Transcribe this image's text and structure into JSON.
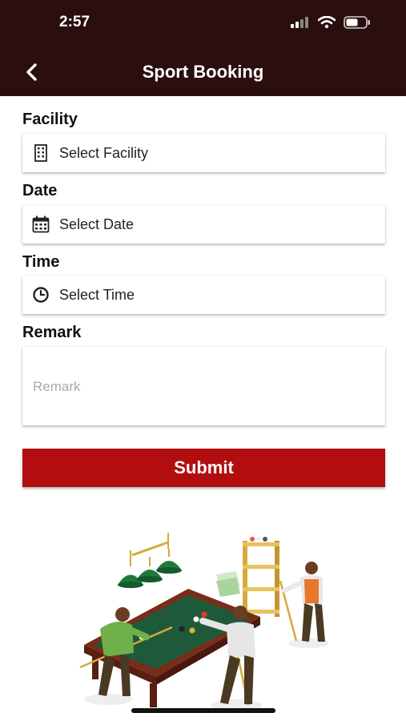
{
  "status_bar": {
    "time": "2:57"
  },
  "header": {
    "title": "Sport Booking"
  },
  "form": {
    "facility": {
      "label": "Facility",
      "value": "Select Facility",
      "icon": "building-icon"
    },
    "date": {
      "label": "Date",
      "value": "Select Date",
      "icon": "calendar-icon"
    },
    "time": {
      "label": "Time",
      "value": "Select Time",
      "icon": "clock-icon"
    },
    "remark": {
      "label": "Remark",
      "placeholder": "Remark"
    },
    "submit_label": "Submit"
  },
  "colors": {
    "header_bg": "#2b0e0e",
    "accent": "#b20e10"
  }
}
